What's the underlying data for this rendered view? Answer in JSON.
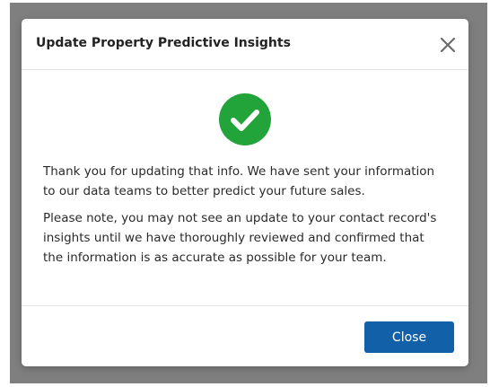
{
  "modal": {
    "title": "Update Property Predictive Insights",
    "close_icon": "close-x-icon",
    "status_icon": "check-circle-icon",
    "messages": [
      "Thank you for updating that info. We have sent your information to our data teams to better predict your future sales.",
      "Please note, you may not see an update to your contact record's insights until we have thoroughly reviewed and confirmed that the information is as accurate as possible for your team."
    ],
    "close_button_label": "Close"
  },
  "colors": {
    "overlay": "#7f7f7f",
    "success": "#22a43a",
    "primary_button": "#1260a8"
  }
}
